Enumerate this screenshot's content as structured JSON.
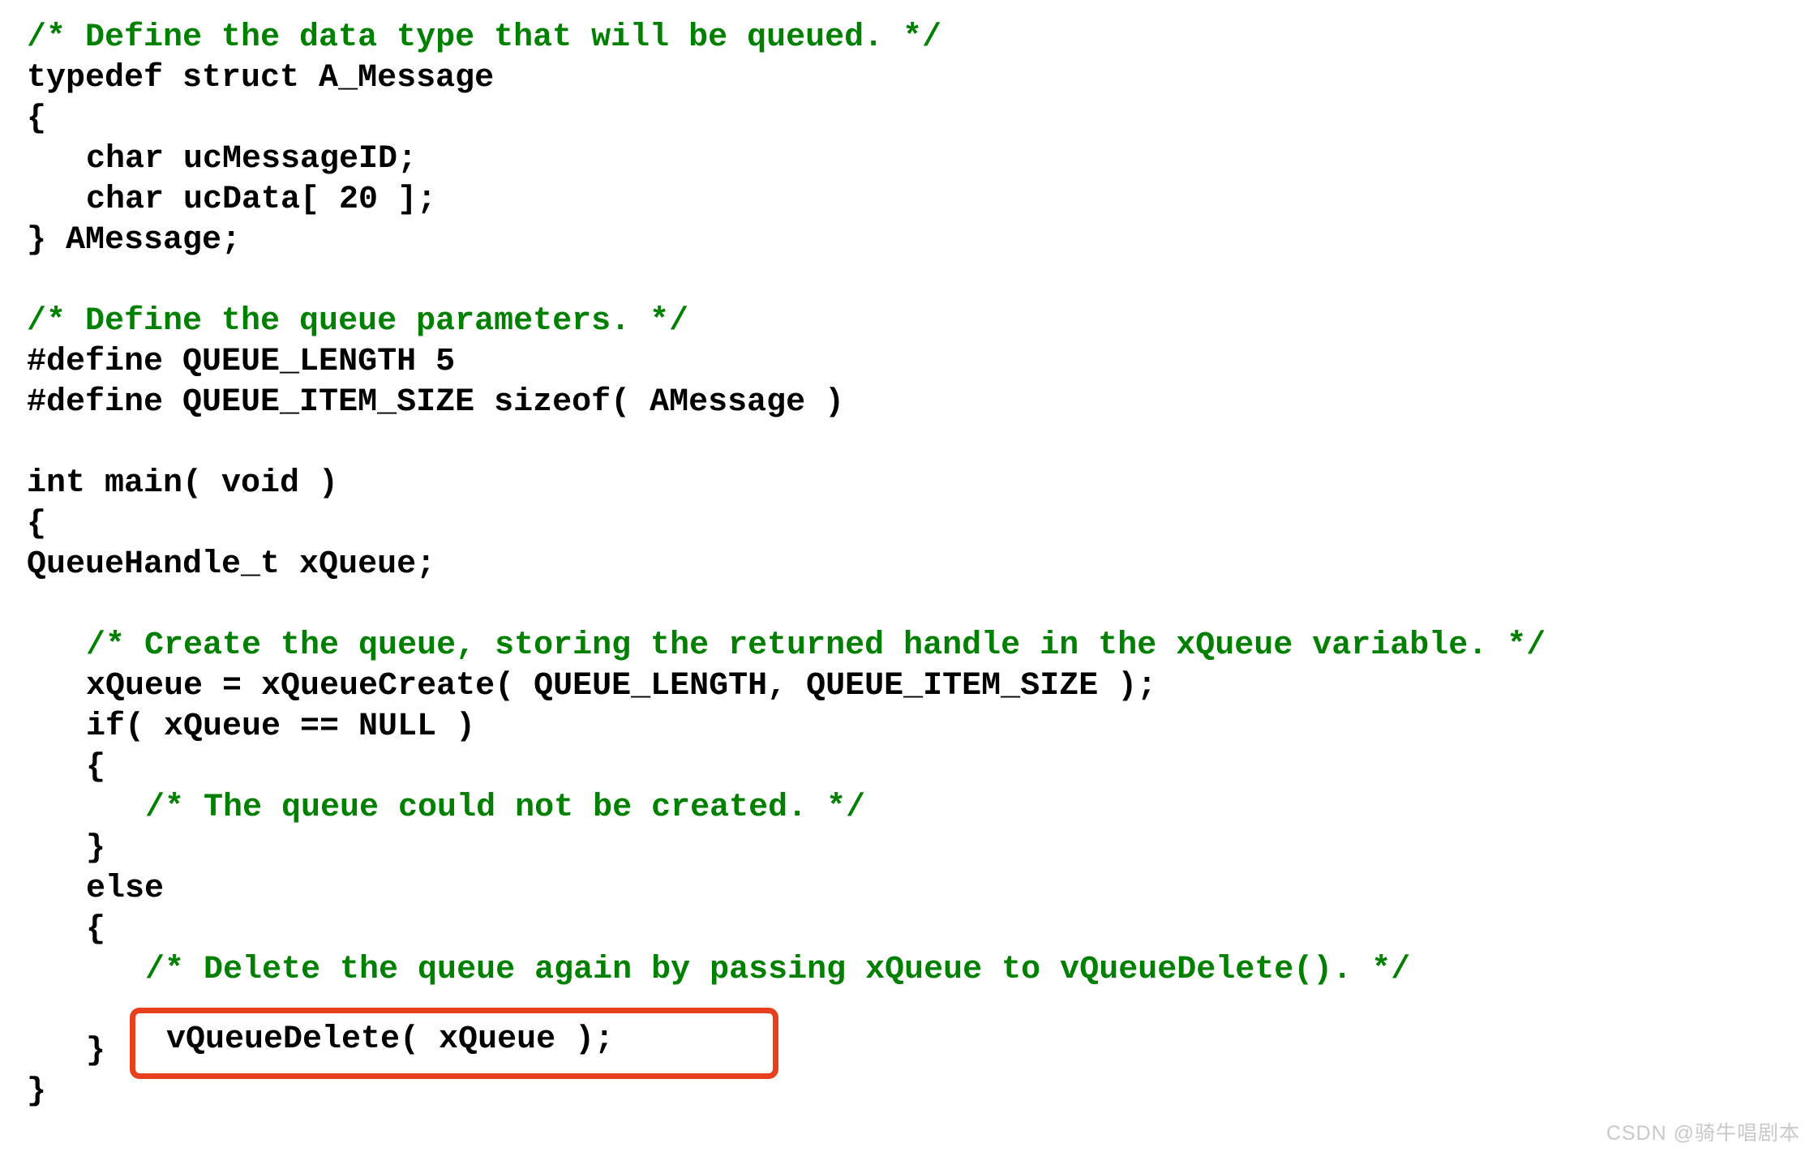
{
  "document": {
    "language": "c",
    "background_color": "#ffffff",
    "text_color": "#000000",
    "comment_color": "#008000",
    "highlight_color": "#E8401F"
  },
  "code": {
    "lines": [
      {
        "indent": 0,
        "type": "comment",
        "text": "/* Define the data type that will be queued. */"
      },
      {
        "indent": 0,
        "type": "code",
        "text": "typedef struct A_Message"
      },
      {
        "indent": 0,
        "type": "code",
        "text": "{"
      },
      {
        "indent": 1,
        "type": "code",
        "text": "char ucMessageID;"
      },
      {
        "indent": 1,
        "type": "code",
        "text": "char ucData[ 20 ];"
      },
      {
        "indent": 0,
        "type": "code",
        "text": "} AMessage;"
      },
      {
        "indent": 0,
        "type": "blank",
        "text": ""
      },
      {
        "indent": 0,
        "type": "comment",
        "text": "/* Define the queue parameters. */"
      },
      {
        "indent": 0,
        "type": "code",
        "text": "#define QUEUE_LENGTH 5"
      },
      {
        "indent": 0,
        "type": "code",
        "text": "#define QUEUE_ITEM_SIZE sizeof( AMessage )"
      },
      {
        "indent": 0,
        "type": "blank",
        "text": ""
      },
      {
        "indent": 0,
        "type": "code",
        "text": "int main( void )"
      },
      {
        "indent": 0,
        "type": "code",
        "text": "{"
      },
      {
        "indent": 0,
        "type": "code",
        "text": "QueueHandle_t xQueue;"
      },
      {
        "indent": 0,
        "type": "blank",
        "text": ""
      },
      {
        "indent": 1,
        "type": "comment",
        "text": "/* Create the queue, storing the returned handle in the xQueue variable. */"
      },
      {
        "indent": 1,
        "type": "code",
        "text": "xQueue = xQueueCreate( QUEUE_LENGTH, QUEUE_ITEM_SIZE );"
      },
      {
        "indent": 1,
        "type": "code",
        "text": "if( xQueue == NULL )"
      },
      {
        "indent": 1,
        "type": "code",
        "text": "{"
      },
      {
        "indent": 2,
        "type": "comment",
        "text": "/* The queue could not be created. */"
      },
      {
        "indent": 1,
        "type": "code",
        "text": "}"
      },
      {
        "indent": 1,
        "type": "code",
        "text": "else"
      },
      {
        "indent": 1,
        "type": "code",
        "text": "{"
      },
      {
        "indent": 2,
        "type": "comment",
        "text": "/* Delete the queue again by passing xQueue to vQueueDelete(). */"
      },
      {
        "indent": 2,
        "type": "code",
        "text": "vQueueDelete( xQueue );"
      },
      {
        "indent": 1,
        "type": "code",
        "text": "}"
      },
      {
        "indent": 0,
        "type": "code",
        "text": "}"
      }
    ]
  },
  "highlight": {
    "target_line_index": 24,
    "label": "vQueueDelete( xQueue );",
    "shape": "rounded-rectangle",
    "color": "#E8401F"
  },
  "watermark": {
    "text": "CSDN @骑牛唱剧本"
  }
}
